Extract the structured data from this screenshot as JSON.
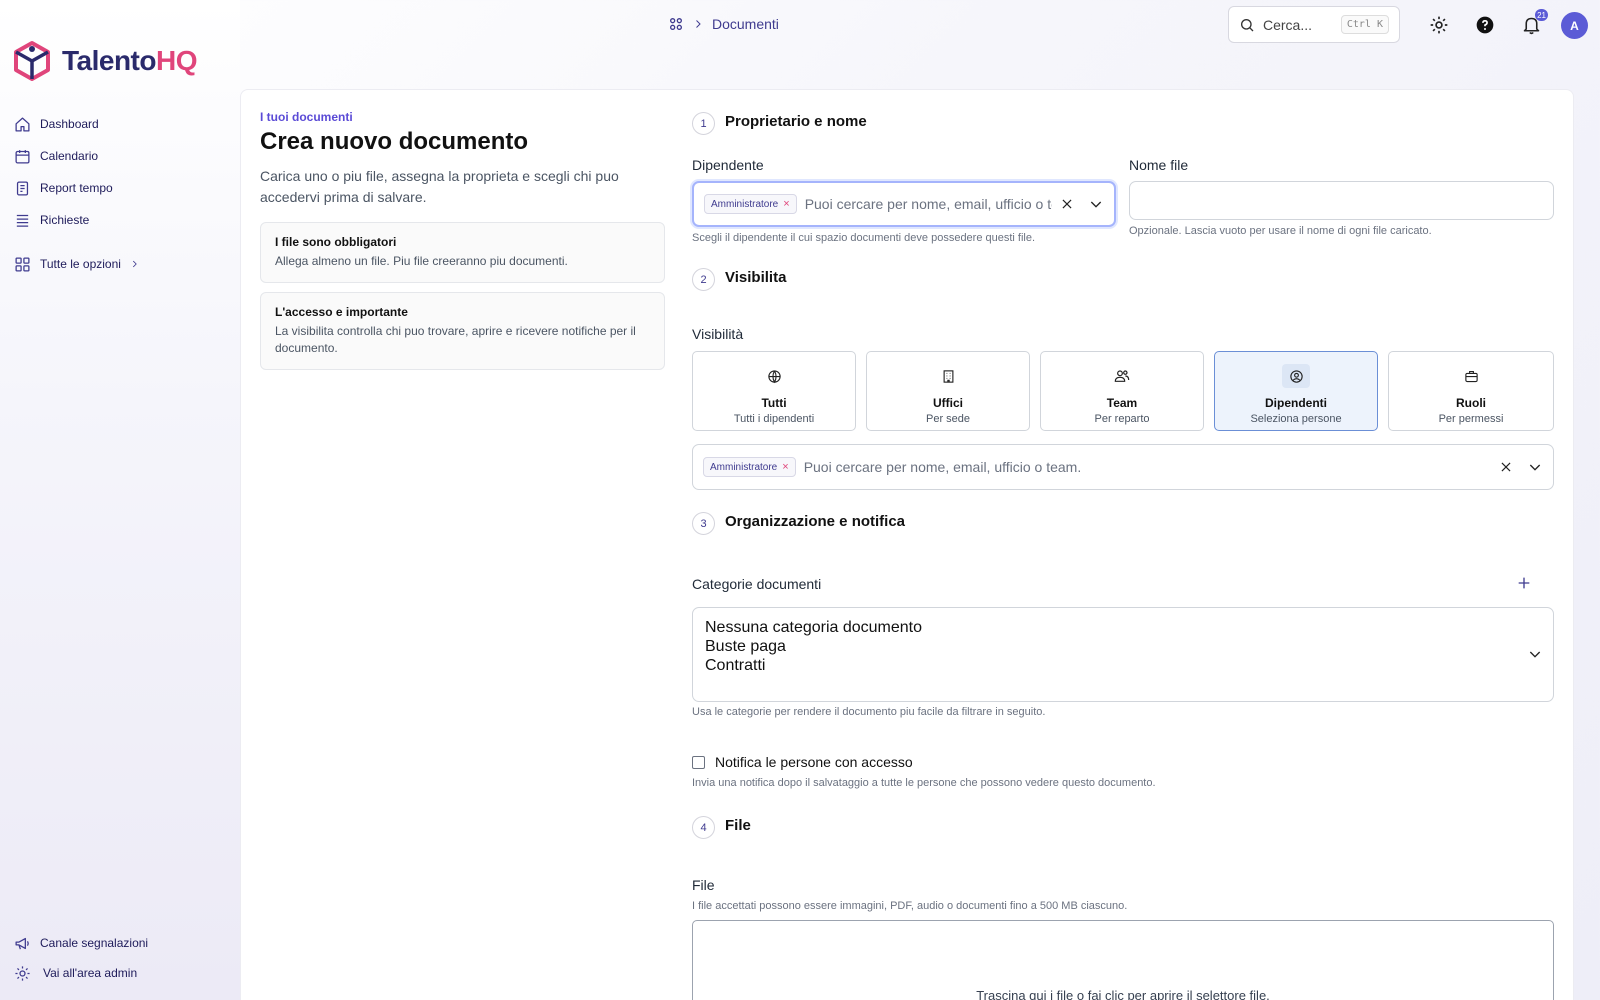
{
  "app": {
    "brand_part1": "Talento",
    "brand_part2": "HQ"
  },
  "sidebar": {
    "items": [
      {
        "label": "Dashboard",
        "icon": "home-icon"
      },
      {
        "label": "Calendario",
        "icon": "calendar-icon"
      },
      {
        "label": "Report tempo",
        "icon": "report-icon"
      },
      {
        "label": "Richieste",
        "icon": "list-icon"
      }
    ],
    "all_options": "Tutte le opzioni",
    "bottom": [
      {
        "label": "Canale segnalazioni",
        "icon": "megaphone-icon"
      },
      {
        "label": "Vai all'area admin",
        "icon": "gear-icon"
      }
    ]
  },
  "topbar": {
    "breadcrumb": "Documenti",
    "search_placeholder": "Cerca...",
    "search_shortcut": "Ctrl K",
    "notifications_count": "21",
    "avatar_initial": "A"
  },
  "intro": {
    "eyebrow": "I tuoi documenti",
    "title": "Crea nuovo documento",
    "description": "Carica uno o piu file, assegna la proprieta e scegli chi puo accedervi prima di salvare.",
    "cards": [
      {
        "title": "I file sono obbligatori",
        "text": "Allega almeno un file. Piu file creeranno piu documenti."
      },
      {
        "title": "L'accesso e importante",
        "text": "La visibilita controlla chi puo trovare, aprire e ricevere notifiche per il documento."
      }
    ]
  },
  "form": {
    "step1": {
      "num": "1",
      "label": "Proprietario e nome"
    },
    "employee_label": "Dipendente",
    "employee_chip": "Amministratore",
    "employee_placeholder": "Puoi cercare per nome, email, ufficio o team.",
    "employee_help": "Scegli il dipendente il cui spazio documenti deve possedere questi file.",
    "filename_label": "Nome file",
    "filename_value": "",
    "filename_help": "Opzionale. Lascia vuoto per usare il nome di ogni file caricato.",
    "step2": {
      "num": "2",
      "label": "Visibilita"
    },
    "visibility_label": "Visibilità",
    "visibility_options": [
      {
        "name": "Tutti",
        "sub": "Tutti i dipendenti",
        "icon": "globe-icon",
        "selected": false
      },
      {
        "name": "Uffici",
        "sub": "Per sede",
        "icon": "building-icon",
        "selected": false
      },
      {
        "name": "Team",
        "sub": "Per reparto",
        "icon": "users-icon",
        "selected": false
      },
      {
        "name": "Dipendenti",
        "sub": "Seleziona persone",
        "icon": "user-circle-icon",
        "selected": true
      },
      {
        "name": "Ruoli",
        "sub": "Per permessi",
        "icon": "briefcase-icon",
        "selected": false
      }
    ],
    "visibility_chip": "Amministratore",
    "visibility_placeholder": "Puoi cercare per nome, email, ufficio o team.",
    "step3": {
      "num": "3",
      "label": "Organizzazione e notifica"
    },
    "categories_label": "Categorie documenti",
    "categories": [
      "Nessuna categoria documento",
      "Buste paga",
      "Contratti"
    ],
    "categories_help": "Usa le categorie per rendere il documento piu facile da filtrare in seguito.",
    "notify_label": "Notifica le persone con accesso",
    "notify_help": "Invia una notifica dopo il salvataggio a tutte le persone che possono vedere questo documento.",
    "step4": {
      "num": "4",
      "label": "File"
    },
    "files_label": "File",
    "files_help": "I file accettati possono essere immagini, PDF, audio o documenti fino a 500 MB ciascuno.",
    "dropzone_text": "Trascina qui i file o fai clic per aprire il selettore file."
  },
  "colors": {
    "accent": "#5b5bd6",
    "brand_pink": "#e0457b",
    "brand_navy": "#2a2a6b",
    "selected_bg": "#edf3fc"
  }
}
